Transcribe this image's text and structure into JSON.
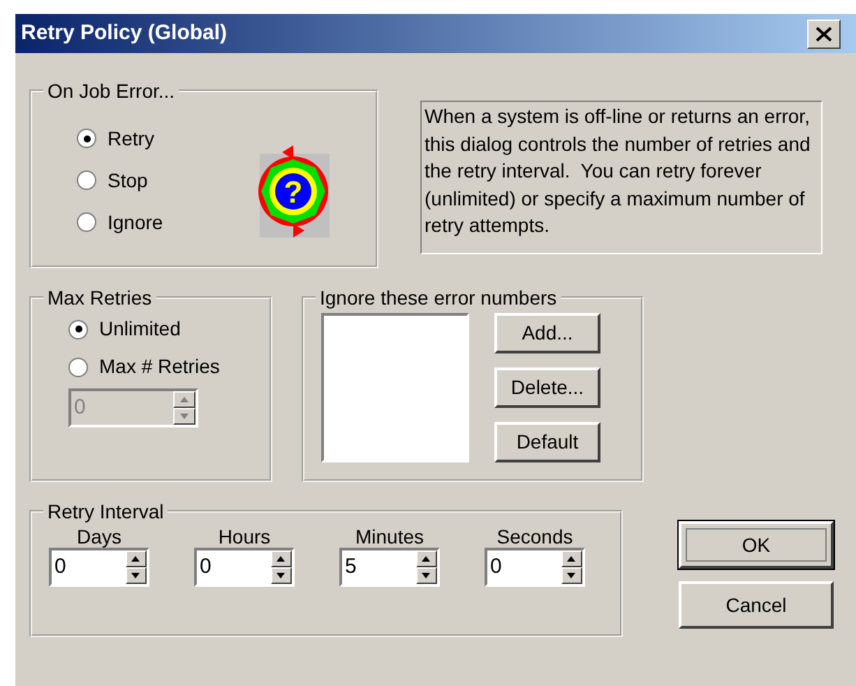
{
  "window": {
    "title": "Retry Policy (Global)"
  },
  "on_job_error": {
    "label": "On Job Error...",
    "icon_glyph": "?",
    "options": [
      {
        "label": "Retry",
        "selected": true
      },
      {
        "label": "Stop",
        "selected": false
      },
      {
        "label": "Ignore",
        "selected": false
      }
    ]
  },
  "description": "When a system is off-line or returns an error, this dialog controls the number of retries and the retry interval.  You can retry forever (unlimited) or specify a maximum number of retry attempts.",
  "max_retries": {
    "label": "Max Retries",
    "options": [
      {
        "label": "Unlimited",
        "selected": true
      },
      {
        "label": "Max # Retries",
        "selected": false
      }
    ],
    "field": {
      "value": "0",
      "disabled": true
    }
  },
  "ignore_errors": {
    "label": "Ignore these error numbers",
    "buttons": [
      "Add...",
      "Delete...",
      "Default"
    ]
  },
  "retry_interval": {
    "label": "Retry Interval",
    "fields": [
      {
        "label": "Days",
        "value": "0"
      },
      {
        "label": "Hours",
        "value": "0"
      },
      {
        "label": "Minutes",
        "value": "5"
      },
      {
        "label": "Seconds",
        "value": "0"
      }
    ]
  },
  "buttons": [
    {
      "label": "OK",
      "default": true
    },
    {
      "label": "Cancel",
      "default": false
    }
  ]
}
